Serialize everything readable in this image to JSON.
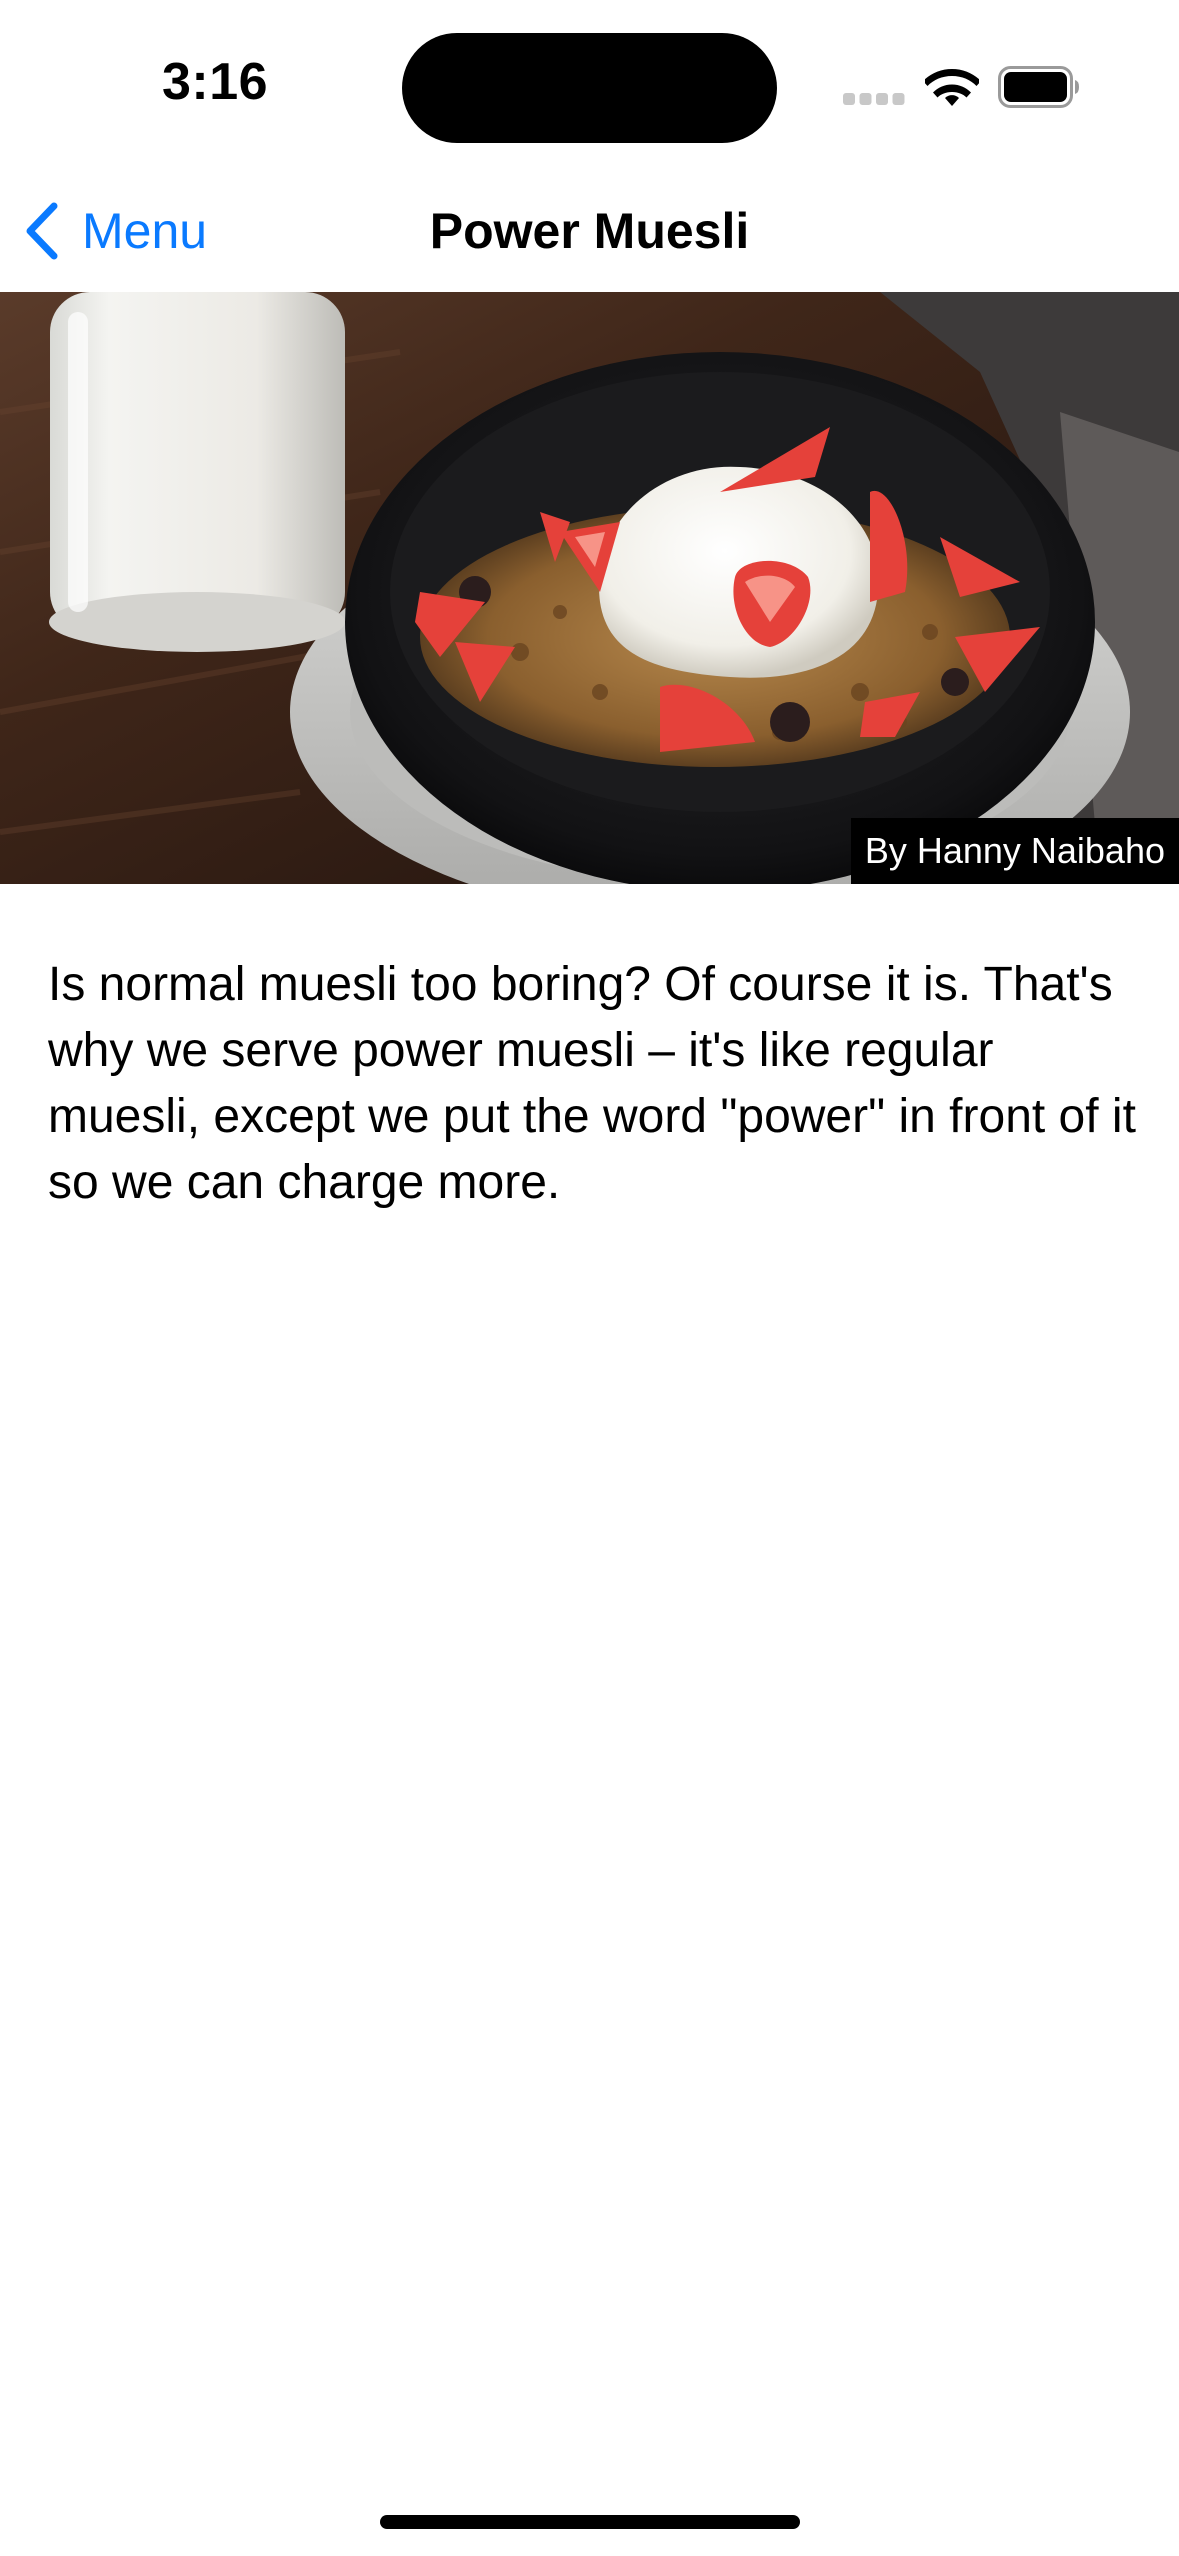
{
  "status_bar": {
    "time": "3:16",
    "icons": [
      "signal-icon",
      "wifi-icon",
      "battery-icon"
    ]
  },
  "nav": {
    "back_label": "Menu",
    "title": "Power Muesli",
    "accent_color": "#0a7aff"
  },
  "hero": {
    "image": "muesli-bowl-with-yogurt-strawberries-and-milk",
    "credit": "By Hanny Naibaho"
  },
  "description": "Is normal muesli too boring? Of course it is. That's why we serve power muesli – it's like regular muesli, except we put the word \"power\" in front of it so we can charge more."
}
